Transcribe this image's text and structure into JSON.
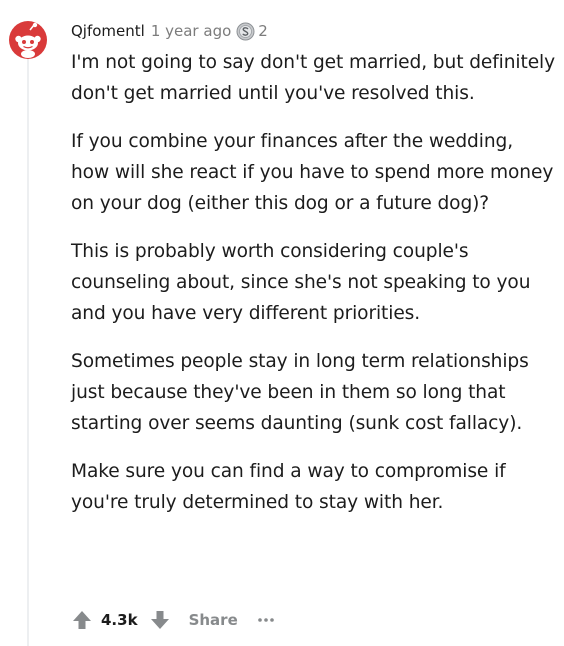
{
  "comment": {
    "username": "Qjfomentl",
    "timestamp": "1 year ago",
    "award_count": "2",
    "paragraphs": [
      "I'm not going to say don't get married, but definitely don't get married until you've resolved this.",
      "If you combine your finances after the wedding, how will she react if you have to spend more money on your dog (either this dog or a future dog)?",
      "This is probably worth considering couple's counseling about, since she's not speaking to you and you have very different priorities.",
      "Sometimes people stay in long term relationships just because they've been in them so long that starting over seems daunting (sunk cost fallacy).",
      "Make sure you can find a way to compromise if you're truly determined to stay with her."
    ]
  },
  "actions": {
    "score": "4.3k",
    "share_label": "Share"
  },
  "icons": {
    "avatar": "snoo-avatar-icon",
    "award": "silver-award-icon",
    "upvote": "upvote-arrow-icon",
    "downvote": "downvote-arrow-icon",
    "more": "more-options-icon"
  },
  "colors": {
    "avatar_red": "#d93a3a",
    "text": "#1c1c1c",
    "meta": "#7c7c7c",
    "action_gray": "#878a8c",
    "thread_line": "#edeff1"
  }
}
